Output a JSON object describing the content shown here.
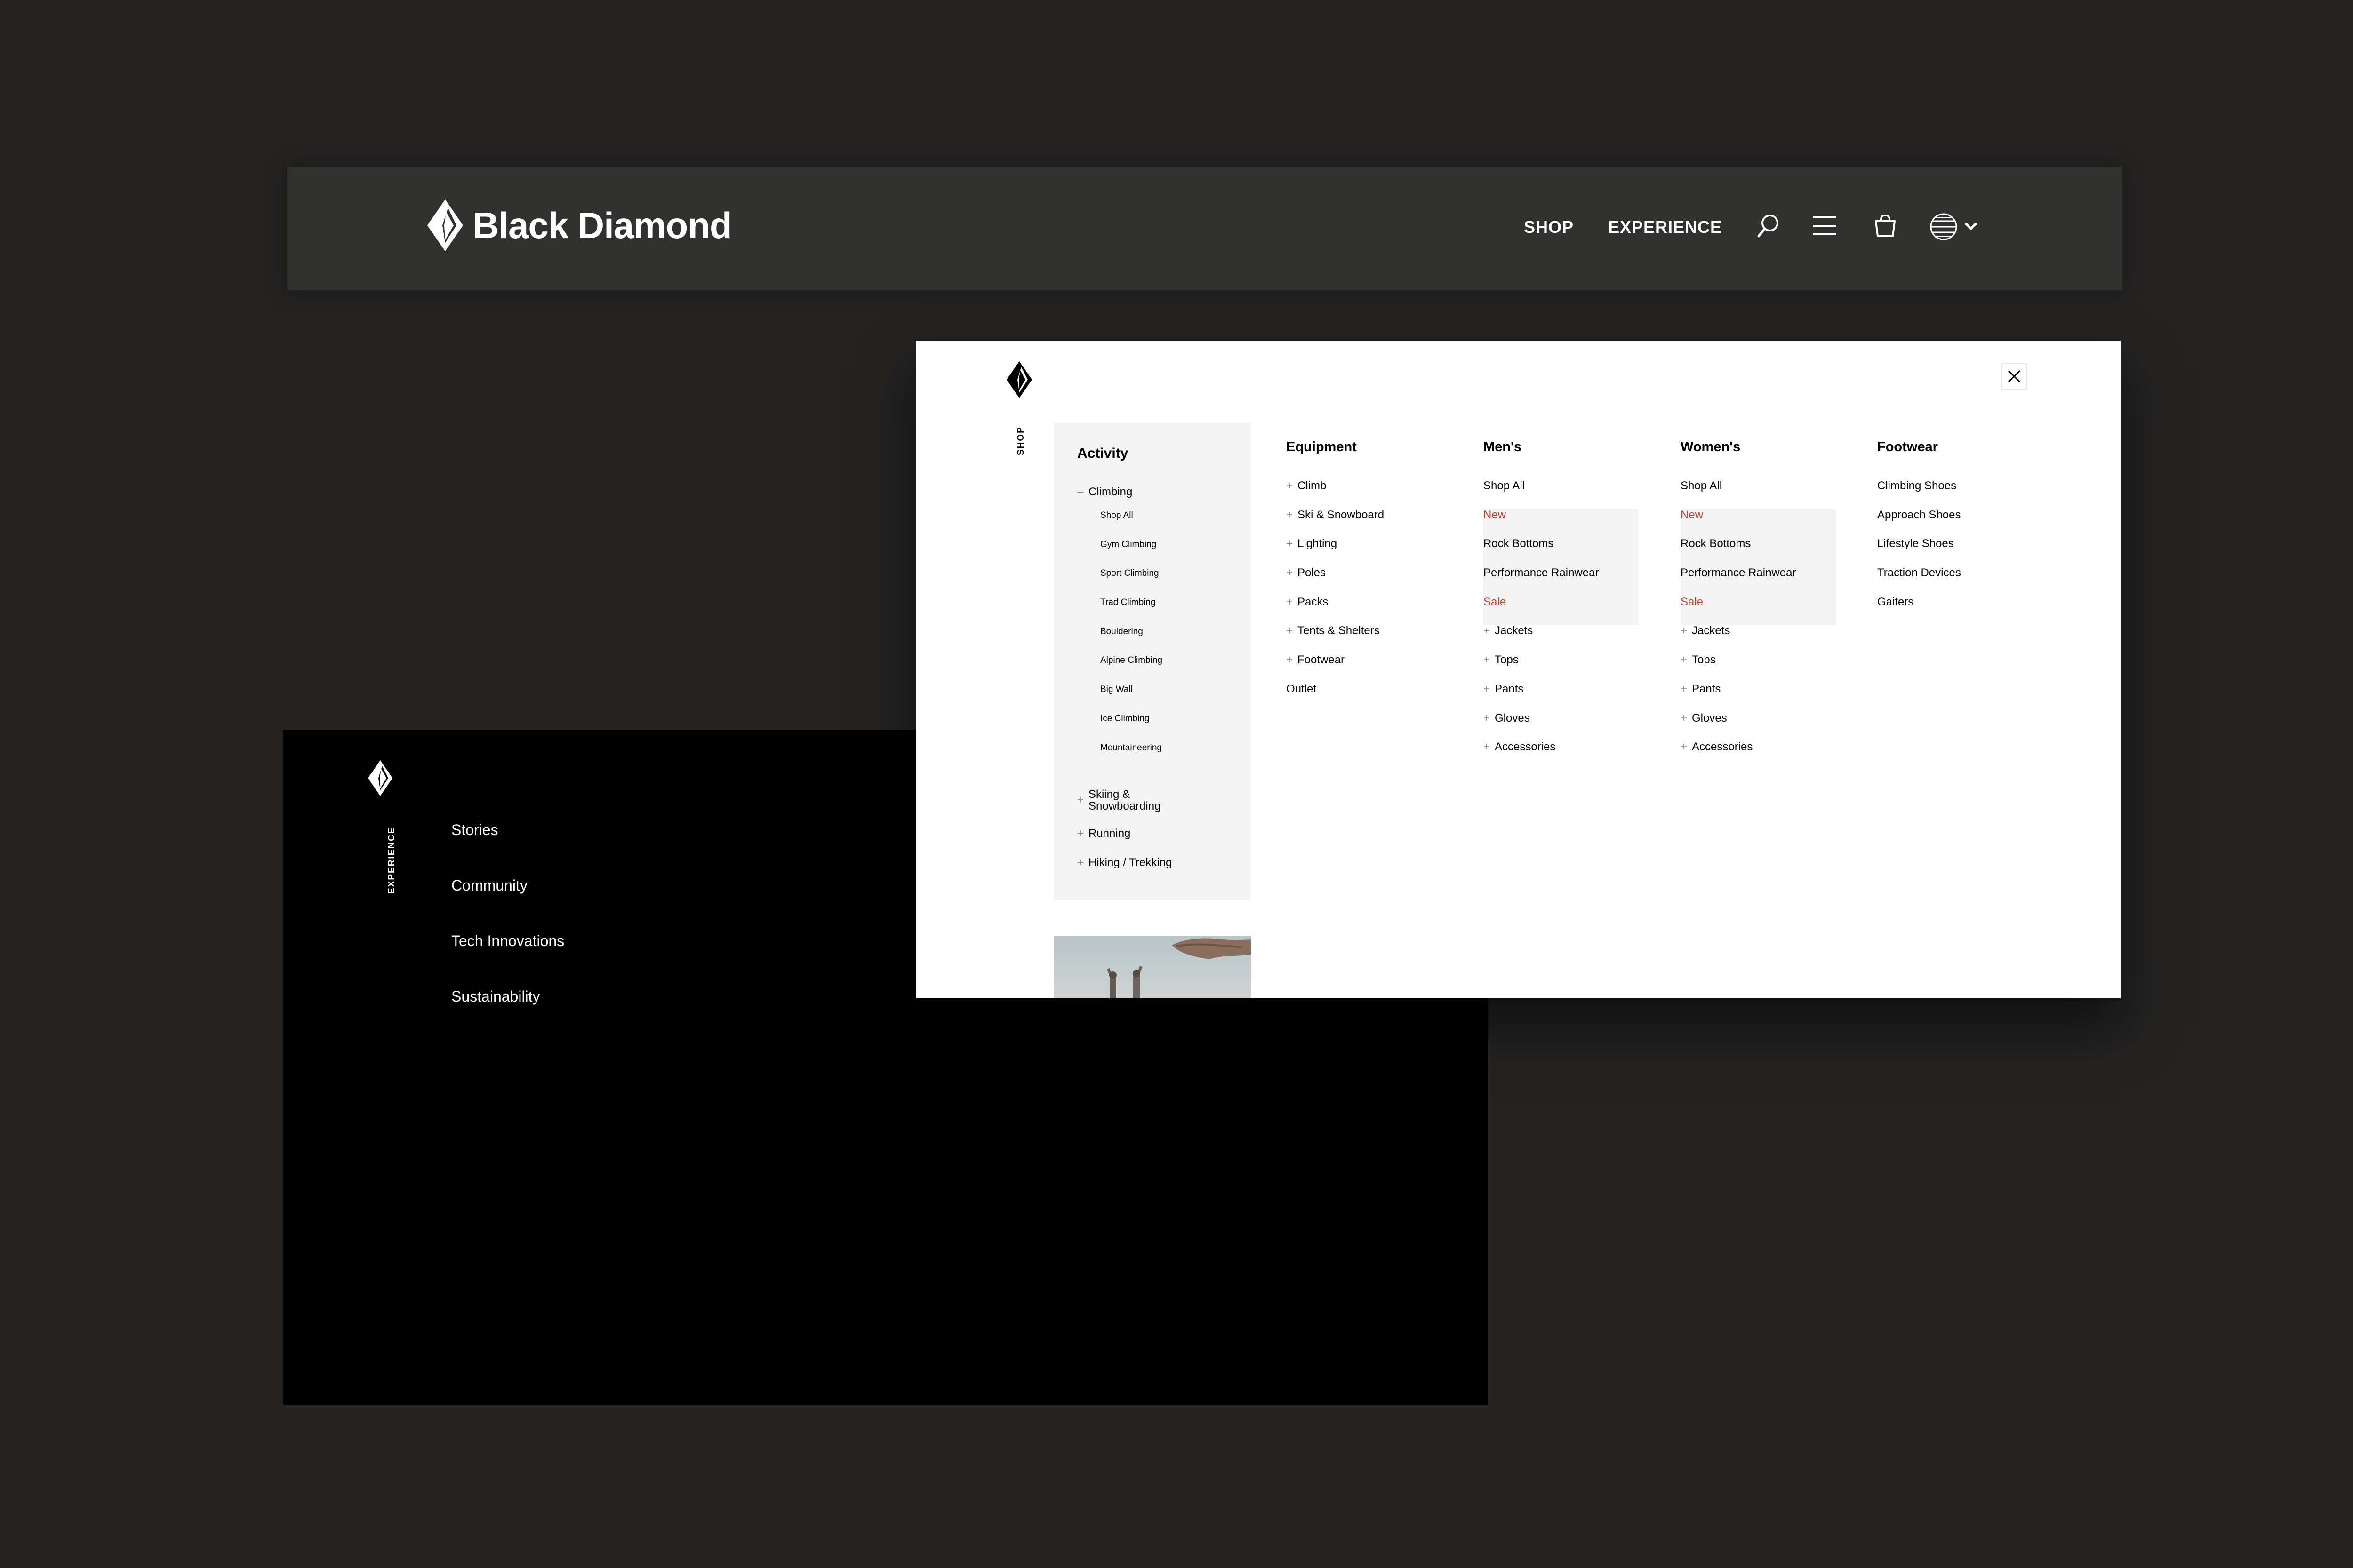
{
  "header": {
    "brand": "Black Diamond",
    "nav": [
      "SHOP",
      "EXPERIENCE"
    ]
  },
  "experience": {
    "vertical_label": "EXPERIENCE",
    "items": [
      "Stories",
      "Community",
      "Tech Innovations",
      "Sustainability"
    ]
  },
  "shop": {
    "vertical_label": "SHOP",
    "activity": {
      "title": "Activity",
      "open_item": "Climbing",
      "open_marker": "–",
      "sub_items": [
        "Shop All",
        "Gym Climbing",
        "Sport Climbing",
        "Trad Climbing",
        "Bouldering",
        "Alpine Climbing",
        "Big Wall",
        "Ice Climbing",
        "Mountaineering"
      ],
      "collapsed_items": [
        "Skiing & Snowboarding",
        "Running",
        "Hiking / Trekking"
      ]
    },
    "expand_marker": "+",
    "equipment": {
      "title": "Equipment",
      "items": [
        "Climb",
        "Ski & Snowboard",
        "Lighting",
        "Poles",
        "Packs",
        "Tents & Shelters",
        "Footwear"
      ],
      "extra": "Outlet"
    },
    "mens": {
      "title": "Men's",
      "shop_all": "Shop All",
      "highlights": [
        "New",
        "Rock Bottoms",
        "Performance Rainwear",
        "Sale"
      ],
      "items": [
        "Jackets",
        "Tops",
        "Pants",
        "Gloves",
        "Accessories"
      ]
    },
    "womens": {
      "title": "Women's",
      "shop_all": "Shop All",
      "highlights": [
        "New",
        "Rock Bottoms",
        "Performance Rainwear",
        "Sale"
      ],
      "items": [
        "Jackets",
        "Tops",
        "Pants",
        "Gloves",
        "Accessories"
      ]
    },
    "footwear": {
      "title": "Footwear",
      "items": [
        "Climbing Shoes",
        "Approach Shoes",
        "Lifestyle Shoes",
        "Traction Devices",
        "Gaiters"
      ]
    }
  },
  "colors": {
    "page_bg": "#242322",
    "header_bg": "#313130",
    "accent_red": "#c2412c",
    "panel_grey": "#f3f3f3"
  },
  "icons": [
    "diamond-logo-icon",
    "search-icon",
    "menu-icon",
    "cart-icon",
    "globe-icon",
    "chevron-down-icon",
    "close-icon",
    "plus-icon",
    "minus-icon"
  ]
}
